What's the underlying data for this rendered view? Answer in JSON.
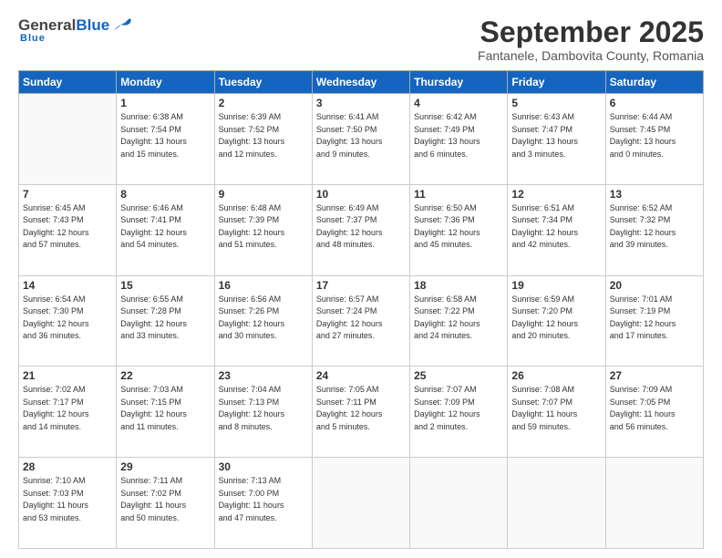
{
  "logo": {
    "general": "General",
    "blue": "Blue",
    "subtitle": "Blue"
  },
  "header": {
    "month": "September 2025",
    "location": "Fantanele, Dambovita County, Romania"
  },
  "weekdays": [
    "Sunday",
    "Monday",
    "Tuesday",
    "Wednesday",
    "Thursday",
    "Friday",
    "Saturday"
  ],
  "weeks": [
    [
      {
        "day": "",
        "info": ""
      },
      {
        "day": "1",
        "info": "Sunrise: 6:38 AM\nSunset: 7:54 PM\nDaylight: 13 hours\nand 15 minutes."
      },
      {
        "day": "2",
        "info": "Sunrise: 6:39 AM\nSunset: 7:52 PM\nDaylight: 13 hours\nand 12 minutes."
      },
      {
        "day": "3",
        "info": "Sunrise: 6:41 AM\nSunset: 7:50 PM\nDaylight: 13 hours\nand 9 minutes."
      },
      {
        "day": "4",
        "info": "Sunrise: 6:42 AM\nSunset: 7:49 PM\nDaylight: 13 hours\nand 6 minutes."
      },
      {
        "day": "5",
        "info": "Sunrise: 6:43 AM\nSunset: 7:47 PM\nDaylight: 13 hours\nand 3 minutes."
      },
      {
        "day": "6",
        "info": "Sunrise: 6:44 AM\nSunset: 7:45 PM\nDaylight: 13 hours\nand 0 minutes."
      }
    ],
    [
      {
        "day": "7",
        "info": "Sunrise: 6:45 AM\nSunset: 7:43 PM\nDaylight: 12 hours\nand 57 minutes."
      },
      {
        "day": "8",
        "info": "Sunrise: 6:46 AM\nSunset: 7:41 PM\nDaylight: 12 hours\nand 54 minutes."
      },
      {
        "day": "9",
        "info": "Sunrise: 6:48 AM\nSunset: 7:39 PM\nDaylight: 12 hours\nand 51 minutes."
      },
      {
        "day": "10",
        "info": "Sunrise: 6:49 AM\nSunset: 7:37 PM\nDaylight: 12 hours\nand 48 minutes."
      },
      {
        "day": "11",
        "info": "Sunrise: 6:50 AM\nSunset: 7:36 PM\nDaylight: 12 hours\nand 45 minutes."
      },
      {
        "day": "12",
        "info": "Sunrise: 6:51 AM\nSunset: 7:34 PM\nDaylight: 12 hours\nand 42 minutes."
      },
      {
        "day": "13",
        "info": "Sunrise: 6:52 AM\nSunset: 7:32 PM\nDaylight: 12 hours\nand 39 minutes."
      }
    ],
    [
      {
        "day": "14",
        "info": "Sunrise: 6:54 AM\nSunset: 7:30 PM\nDaylight: 12 hours\nand 36 minutes."
      },
      {
        "day": "15",
        "info": "Sunrise: 6:55 AM\nSunset: 7:28 PM\nDaylight: 12 hours\nand 33 minutes."
      },
      {
        "day": "16",
        "info": "Sunrise: 6:56 AM\nSunset: 7:26 PM\nDaylight: 12 hours\nand 30 minutes."
      },
      {
        "day": "17",
        "info": "Sunrise: 6:57 AM\nSunset: 7:24 PM\nDaylight: 12 hours\nand 27 minutes."
      },
      {
        "day": "18",
        "info": "Sunrise: 6:58 AM\nSunset: 7:22 PM\nDaylight: 12 hours\nand 24 minutes."
      },
      {
        "day": "19",
        "info": "Sunrise: 6:59 AM\nSunset: 7:20 PM\nDaylight: 12 hours\nand 20 minutes."
      },
      {
        "day": "20",
        "info": "Sunrise: 7:01 AM\nSunset: 7:19 PM\nDaylight: 12 hours\nand 17 minutes."
      }
    ],
    [
      {
        "day": "21",
        "info": "Sunrise: 7:02 AM\nSunset: 7:17 PM\nDaylight: 12 hours\nand 14 minutes."
      },
      {
        "day": "22",
        "info": "Sunrise: 7:03 AM\nSunset: 7:15 PM\nDaylight: 12 hours\nand 11 minutes."
      },
      {
        "day": "23",
        "info": "Sunrise: 7:04 AM\nSunset: 7:13 PM\nDaylight: 12 hours\nand 8 minutes."
      },
      {
        "day": "24",
        "info": "Sunrise: 7:05 AM\nSunset: 7:11 PM\nDaylight: 12 hours\nand 5 minutes."
      },
      {
        "day": "25",
        "info": "Sunrise: 7:07 AM\nSunset: 7:09 PM\nDaylight: 12 hours\nand 2 minutes."
      },
      {
        "day": "26",
        "info": "Sunrise: 7:08 AM\nSunset: 7:07 PM\nDaylight: 11 hours\nand 59 minutes."
      },
      {
        "day": "27",
        "info": "Sunrise: 7:09 AM\nSunset: 7:05 PM\nDaylight: 11 hours\nand 56 minutes."
      }
    ],
    [
      {
        "day": "28",
        "info": "Sunrise: 7:10 AM\nSunset: 7:03 PM\nDaylight: 11 hours\nand 53 minutes."
      },
      {
        "day": "29",
        "info": "Sunrise: 7:11 AM\nSunset: 7:02 PM\nDaylight: 11 hours\nand 50 minutes."
      },
      {
        "day": "30",
        "info": "Sunrise: 7:13 AM\nSunset: 7:00 PM\nDaylight: 11 hours\nand 47 minutes."
      },
      {
        "day": "",
        "info": ""
      },
      {
        "day": "",
        "info": ""
      },
      {
        "day": "",
        "info": ""
      },
      {
        "day": "",
        "info": ""
      }
    ]
  ]
}
